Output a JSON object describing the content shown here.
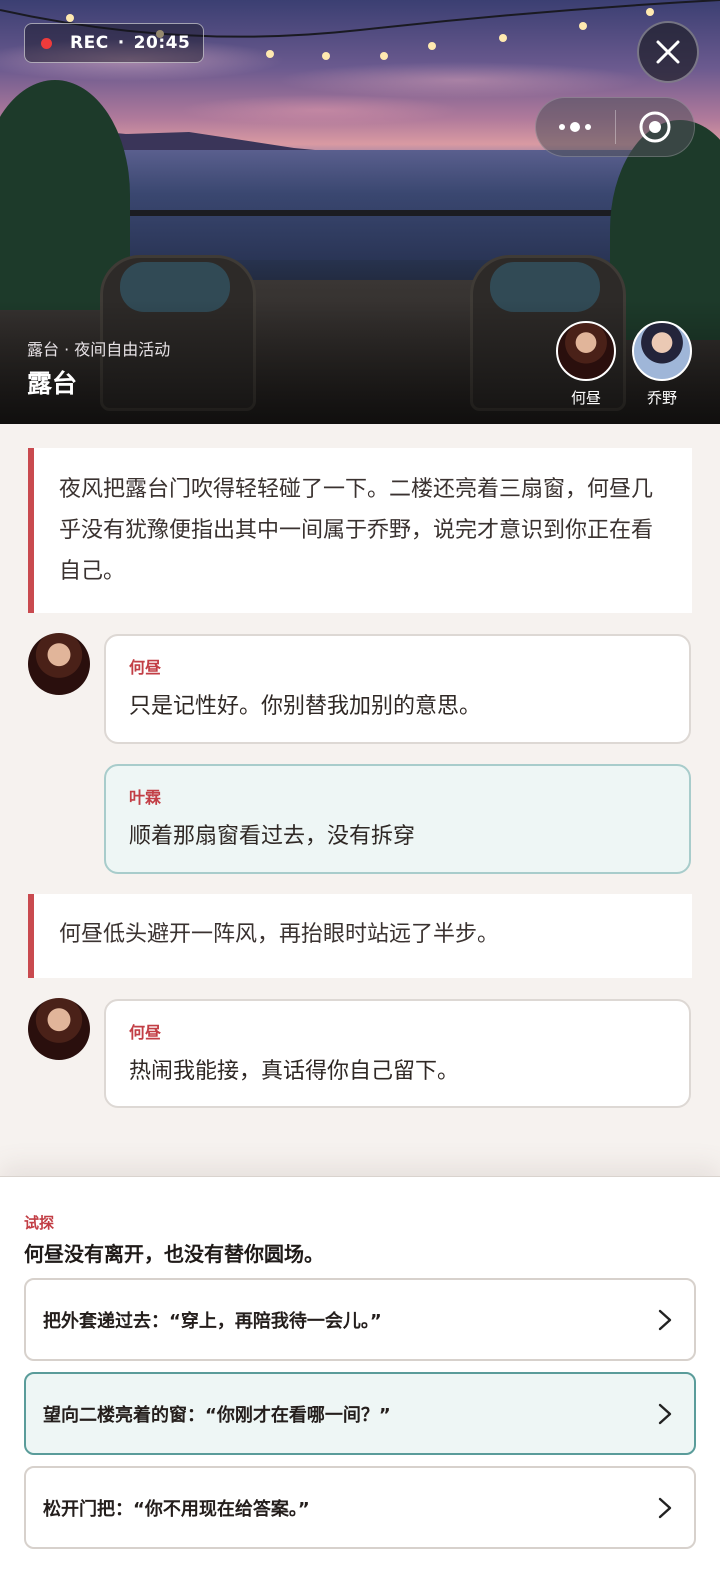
{
  "status": {
    "rec_label": "REC",
    "separator": "·",
    "time": "20:45"
  },
  "scene": {
    "subtitle": "露台 · 夜间自由活动",
    "title": "露台"
  },
  "characters": [
    {
      "name": "何昼"
    },
    {
      "name": "乔野"
    }
  ],
  "story": [
    {
      "type": "narration",
      "text": "夜风把露台门吹得轻轻碰了一下。二楼还亮着三扇窗，何昼几乎没有犹豫便指出其中一间属于乔野，说完才意识到你正在看自己。"
    },
    {
      "type": "npc",
      "speaker": "何昼",
      "text": "只是记性好。你别替我加别的意思。"
    },
    {
      "type": "player",
      "speaker": "叶霖",
      "text": "顺着那扇窗看过去，没有拆穿"
    },
    {
      "type": "narration",
      "text": "何昼低头避开一阵风，再抬眼时站远了半步。"
    },
    {
      "type": "npc",
      "speaker": "何昼",
      "text": "热闹我能接，真话得你自己留下。"
    }
  ],
  "choice_panel": {
    "tag": "试探",
    "prompt": "何昼没有离开，也没有替你圆场。",
    "options": [
      {
        "label": "把外套递过去：“穿上，再陪我待一会儿。”",
        "selected": false
      },
      {
        "label": "望向二楼亮着的窗：“你刚才在看哪一间？”",
        "selected": true
      },
      {
        "label": "松开门把：“你不用现在给答案。”",
        "selected": false
      }
    ]
  },
  "colors": {
    "accent_red": "#c94a4f",
    "selected_bg": "#eef6f5",
    "selected_border": "#5a9c9a",
    "rec_dot": "#ee3b3b"
  },
  "icons": [
    "close-icon",
    "more-dots-icon",
    "record-target-icon",
    "chevron-right-icon"
  ]
}
